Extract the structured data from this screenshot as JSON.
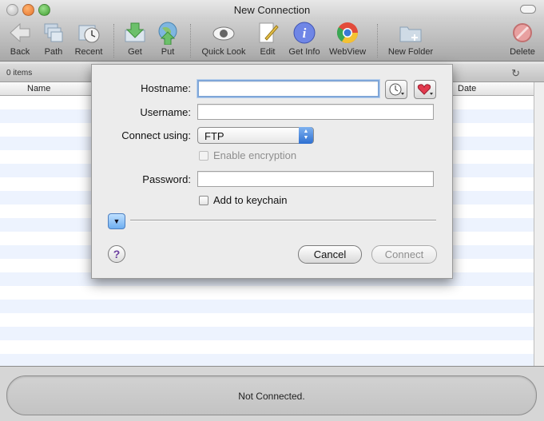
{
  "window": {
    "title": "New Connection"
  },
  "toolbar": {
    "back": "Back",
    "path": "Path",
    "recent": "Recent",
    "get": "Get",
    "put": "Put",
    "quick_look": "Quick Look",
    "edit": "Edit",
    "get_info": "Get Info",
    "webview": "WebView",
    "new_folder": "New Folder",
    "delete": "Delete"
  },
  "browser": {
    "items_count": "0 items",
    "columns": [
      "Name",
      "Date"
    ]
  },
  "dialog": {
    "hostname_label": "Hostname:",
    "hostname_value": "",
    "username_label": "Username:",
    "username_value": "",
    "connect_using_label": "Connect using:",
    "protocol": "FTP",
    "enable_encryption": "Enable encryption",
    "password_label": "Password:",
    "password_value": "",
    "add_to_keychain": "Add to keychain",
    "help": "?",
    "cancel": "Cancel",
    "connect": "Connect"
  },
  "status": {
    "text": "Not Connected."
  },
  "colors": {
    "accent": "#3d7fd9",
    "stripe": "#edf3fe"
  }
}
